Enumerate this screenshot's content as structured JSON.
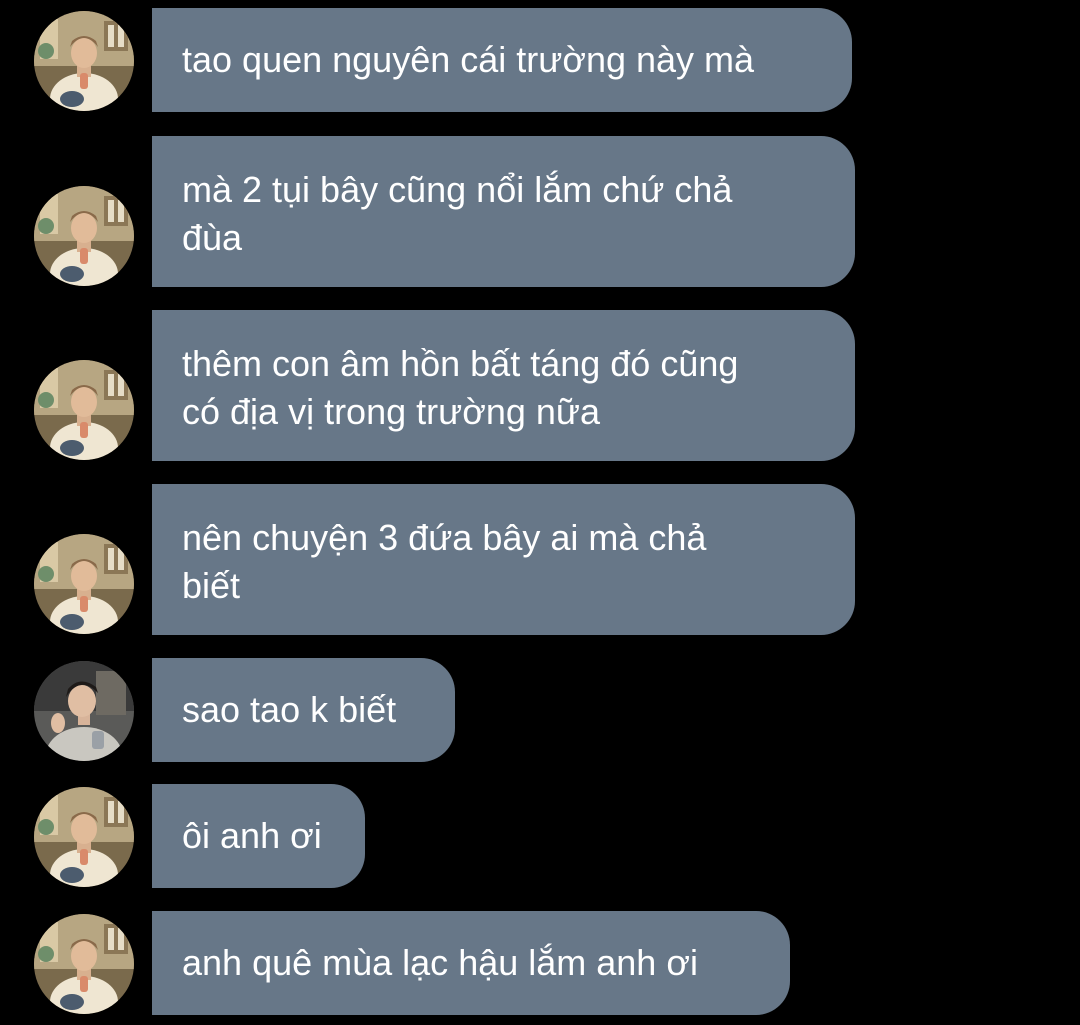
{
  "messages": [
    {
      "sender": "friend_a",
      "text": "tao quen nguyên cái trường này mà"
    },
    {
      "sender": "friend_a",
      "text": "mà 2 tụi bây cũng nổi lắm chứ chả\nđùa"
    },
    {
      "sender": "friend_a",
      "text": "thêm con âm hồn bất táng đó cũng\ncó địa vị trong trường nữa"
    },
    {
      "sender": "friend_a",
      "text": "nên chuyện 3 đứa bây ai mà chả\nbiết"
    },
    {
      "sender": "friend_b",
      "text": "sao tao k biết"
    },
    {
      "sender": "friend_a",
      "text": "ôi anh ơi"
    },
    {
      "sender": "friend_a",
      "text": "anh quê mùa lạc hậu lắm anh ơi"
    }
  ],
  "theme": {
    "background": "#000000",
    "bubble": "#677788",
    "text": "#ffffff"
  }
}
